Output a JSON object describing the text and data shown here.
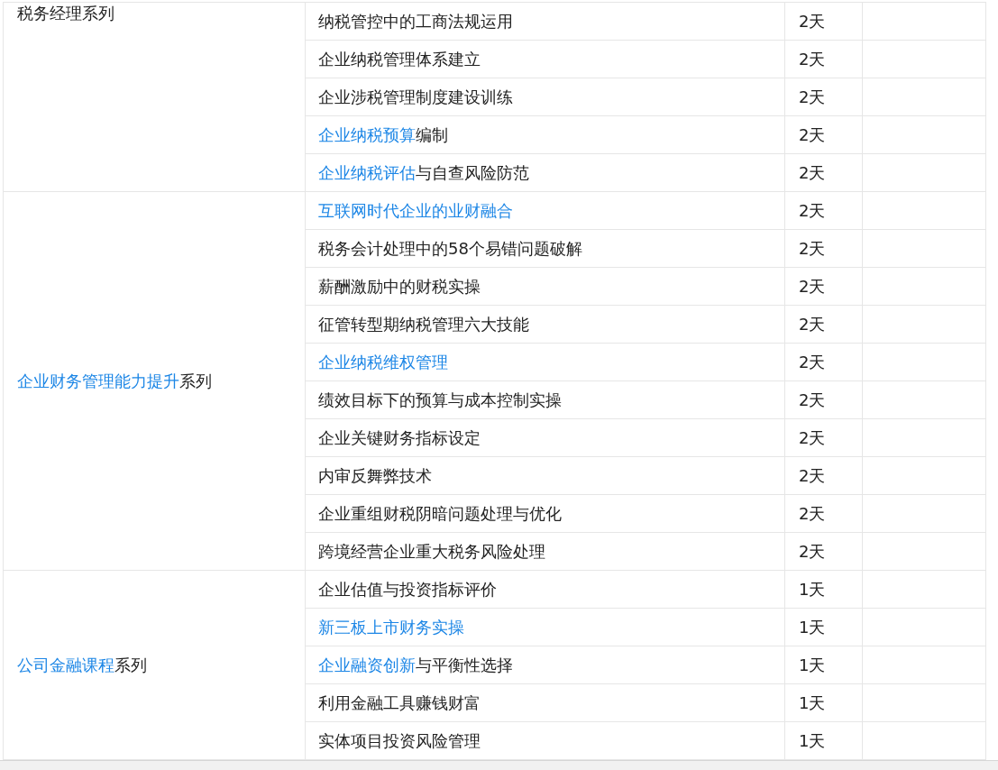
{
  "groups": [
    {
      "label": {
        "text": "税务经理系列"
      },
      "courses": [
        {
          "text": "纳税管控中的工商法规运用",
          "days": "2天"
        },
        {
          "text": "企业纳税管理体系建立",
          "days": "2天"
        },
        {
          "text": "企业涉税管理制度建设训练",
          "days": "2天"
        },
        {
          "link": "企业纳税预算",
          "text": "编制",
          "days": "2天"
        },
        {
          "link": "企业纳税评估",
          "text": "与自查风险防范",
          "days": "2天"
        }
      ]
    },
    {
      "label": {
        "link": "企业财务管理能力提升",
        "text": "系列"
      },
      "courses": [
        {
          "link": "互联网时代企业的业财融合",
          "days": "2天"
        },
        {
          "text": "税务会计处理中的58个易错问题破解",
          "days": "2天"
        },
        {
          "text": "薪酬激励中的财税实操",
          "days": "2天"
        },
        {
          "text": "征管转型期纳税管理六大技能",
          "days": "2天"
        },
        {
          "link": "企业纳税维权管理",
          "days": "2天"
        },
        {
          "text": "绩效目标下的预算与成本控制实操",
          "days": "2天"
        },
        {
          "text": "企业关键财务指标设定",
          "days": "2天"
        },
        {
          "text": "内审反舞弊技术",
          "days": "2天"
        },
        {
          "text": "企业重组财税阴暗问题处理与优化",
          "days": "2天"
        },
        {
          "text": "跨境经营企业重大税务风险处理",
          "days": "2天"
        }
      ]
    },
    {
      "label": {
        "link": "公司金融课程",
        "text": "系列"
      },
      "courses": [
        {
          "text": "企业估值与投资指标评价",
          "days": "1天"
        },
        {
          "link": "新三板上市财务实操",
          "days": "1天"
        },
        {
          "link": "企业融资创新",
          "text": "与平衡性选择",
          "days": "1天"
        },
        {
          "text": "利用金融工具赚钱财富",
          "days": "1天"
        },
        {
          "text": "实体项目投资风险管理",
          "days": "1天"
        }
      ]
    }
  ]
}
